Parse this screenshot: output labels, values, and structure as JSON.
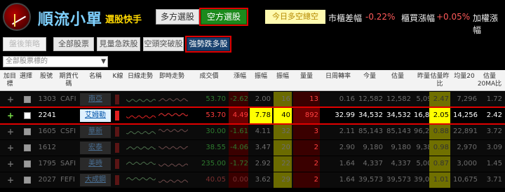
{
  "app": {
    "title": "順流小單",
    "subtitle": "選股快手"
  },
  "modes": {
    "long": "多方選股",
    "short": "空方選股"
  },
  "header": {
    "today_label": "今日多空總空",
    "market_label": "市櫃差幅",
    "market_value": "-0.22%",
    "listed_label": "櫃買漲幅",
    "listed_value": "+0.05%",
    "weighted_label": "加權漲幅"
  },
  "tabs": [
    "盤後策略",
    "全部股票",
    "見量急跌股",
    "空頭突破股",
    "強勢跌多股"
  ],
  "dropdown": {
    "value": "全部股票標的"
  },
  "columns": [
    "加目標",
    "選擇",
    "股號",
    "期貨代碼",
    "名稱",
    "K線",
    "日線走勢",
    "即時走勢",
    "成交價",
    "漲幅",
    "振幅",
    "振幅",
    "量量",
    "日周轉率",
    "今量",
    "估量",
    "昨量",
    "估量昨比",
    "均量20",
    "估量20MA比"
  ],
  "colors": {
    "accent_red": "#e00000",
    "active_tab": "#17406e",
    "short_button": "#1c8a1c"
  },
  "rows": [
    {
      "code": "1303",
      "fut": "CAFI",
      "name": "南亞",
      "price": "53.70",
      "chg": "-2.62",
      "amp": "2.00",
      "amp2": "16",
      "vol_ratio": "13",
      "turnover": "0.16",
      "vol_now": "12,582",
      "vol_est": "12,582",
      "vol_prev": "5,090",
      "est_ratio": "2.47",
      "avg20": "7,296",
      "ma_ratio": "1.72",
      "dim": true
    },
    {
      "code": "2241",
      "fut": "",
      "name": "艾姆勒",
      "price": "53.70",
      "chg": "4.49",
      "amp": "7.78",
      "amp2": "40",
      "vol_ratio": "892",
      "turnover": "32.99",
      "vol_now": "34,532",
      "vol_est": "34,532",
      "vol_prev": "16,826",
      "est_ratio": "2.05",
      "avg20": "14,256",
      "ma_ratio": "2.42",
      "dim": false
    },
    {
      "code": "1605",
      "fut": "CSFI",
      "name": "華新",
      "price": "30.00",
      "chg": "-1.61",
      "amp": "4.11",
      "amp2": "32",
      "vol_ratio": "3",
      "turnover": "2.11",
      "vol_now": "85,143",
      "vol_est": "85,143",
      "vol_prev": "96,288",
      "est_ratio": "0.88",
      "avg20": "22,891",
      "ma_ratio": "3.72",
      "dim": true
    },
    {
      "code": "1612",
      "fut": "",
      "name": "宏泰",
      "price": "38.55",
      "chg": "-4.06",
      "amp": "3.47",
      "amp2": "20",
      "vol_ratio": "2",
      "turnover": "2.90",
      "vol_now": "9,180",
      "vol_est": "9,180",
      "vol_prev": "9,382",
      "est_ratio": "0.98",
      "avg20": "2,970",
      "ma_ratio": "3.09",
      "dim": true
    },
    {
      "code": "1795",
      "fut": "SAFI",
      "name": "美時",
      "price": "235.00",
      "chg": "-1.72",
      "amp": "2.92",
      "amp2": "22",
      "vol_ratio": "2",
      "turnover": "1.64",
      "vol_now": "4,337",
      "vol_est": "4,337",
      "vol_prev": "5,004",
      "est_ratio": "0.87",
      "avg20": "3,000",
      "ma_ratio": "1.45",
      "dim": true
    },
    {
      "code": "2027",
      "fut": "FEFI",
      "name": "大成鋼",
      "price": "40.05",
      "chg": "0.00",
      "amp": "3.62",
      "amp2": "29",
      "vol_ratio": "2",
      "turnover": "1.64",
      "vol_now": "39,573",
      "vol_est": "39,573",
      "vol_prev": "39,025",
      "est_ratio": "1.01",
      "avg20": "10,675",
      "ma_ratio": "3.71",
      "dim": true
    }
  ]
}
